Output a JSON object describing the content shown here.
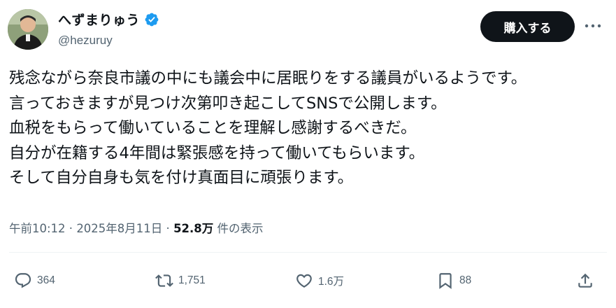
{
  "author": {
    "display_name": "へずまりゅう",
    "handle": "@hezuruy",
    "verified": true,
    "verified_color": "#1d9bf0"
  },
  "buttons": {
    "buy": "購入する",
    "more": "more-icon"
  },
  "tweet": {
    "lines": [
      "残念ながら奈良市議の中にも議会中に居眠りをする議員がいるようです。",
      "言っておきますが見つけ次第叩き起こしてSNSで公開します。",
      "血税をもらって働いていることを理解し感謝するべきだ。",
      "自分が在籍する4年間は緊張感を持って働いてもらいます。",
      "そして自分自身も気を付け真面目に頑張ります。"
    ]
  },
  "meta": {
    "time": "午前10:12",
    "sep1": " · ",
    "date": "2025年8月11日",
    "sep2": " · ",
    "views_count": "52.8万",
    "views_label": " 件の表示"
  },
  "actions": {
    "reply": {
      "icon": "reply-icon",
      "count": "364"
    },
    "repost": {
      "icon": "repost-icon",
      "count": "1,751"
    },
    "like": {
      "icon": "heart-icon",
      "count": "1.6万"
    },
    "bookmark": {
      "icon": "bookmark-icon",
      "count": "88"
    },
    "share": {
      "icon": "share-icon"
    }
  },
  "colors": {
    "text": "#0f1419",
    "secondary": "#536471",
    "button_bg": "#0f1419"
  }
}
